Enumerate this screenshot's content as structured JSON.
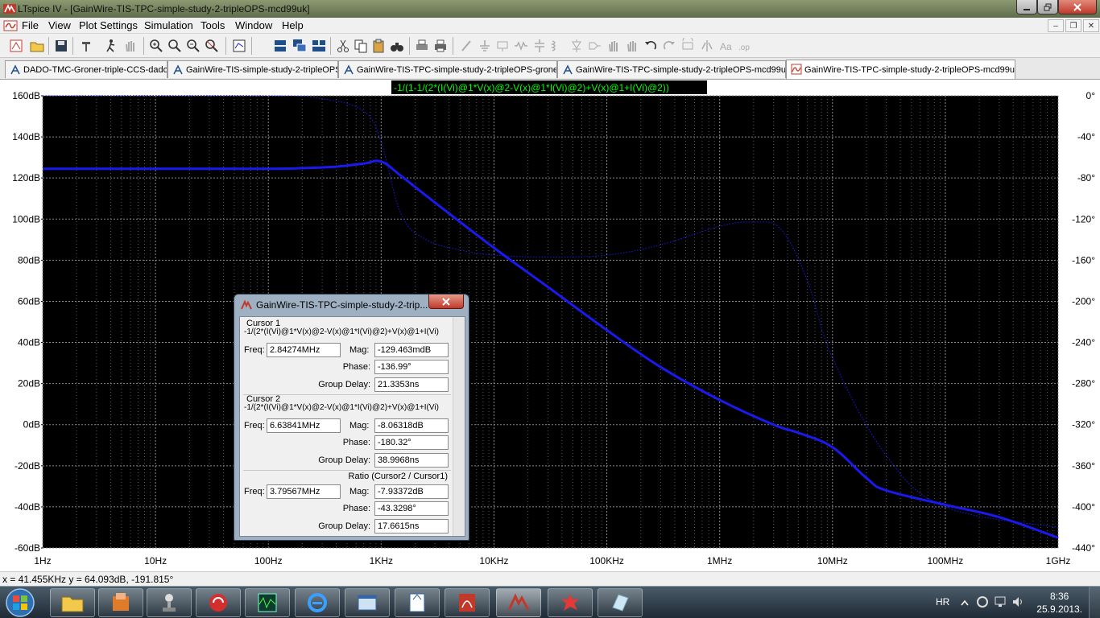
{
  "window": {
    "title": "LTspice IV - [GainWire-TIS-TPC-simple-study-2-tripleOPS-mcd99uk]"
  },
  "menu": [
    "File",
    "View",
    "Plot Settings",
    "Simulation",
    "Tools",
    "Window",
    "Help"
  ],
  "tabs": [
    {
      "label": "DADO-TMC-Groner-triple-CCS-dado",
      "kind": "schematic"
    },
    {
      "label": "GainWire-TIS-simple-study-2-tripleOPS",
      "kind": "schematic"
    },
    {
      "label": "GainWire-TIS-TPC-simple-study-2-tripleOPS-groner",
      "kind": "schematic"
    },
    {
      "label": "GainWire-TIS-TPC-simple-study-2-tripleOPS-mcd99uk",
      "kind": "schematic"
    },
    {
      "label": "GainWire-TIS-TPC-simple-study-2-tripleOPS-mcd99uk",
      "kind": "waveform",
      "active": true
    }
  ],
  "plot": {
    "trace_label": "-1/(1-1/(2*(I(Vi)@1*V(x)@2-V(x)@1*I(Vi)@2)+V(x)@1+I(Vi)@2))",
    "colors": {
      "background": "#000000",
      "grid": "#8a8a8a",
      "trace": "#1a1aee",
      "label": "#00ff00",
      "axis_text": "#000000"
    }
  },
  "chart_data": {
    "type": "line",
    "title": "",
    "xlabel": "",
    "ylabel": "",
    "x_scale": "log",
    "xlim": [
      1,
      1000000000
    ],
    "ylim": [
      -60,
      160
    ],
    "y2lim": [
      -440,
      0
    ],
    "x_tick_labels": [
      "1Hz",
      "10Hz",
      "100Hz",
      "1KHz",
      "10KHz",
      "100KHz",
      "1MHz",
      "10MHz",
      "100MHz",
      "1GHz"
    ],
    "y_tick_labels": [
      "160dB",
      "140dB",
      "120dB",
      "100dB",
      "80dB",
      "60dB",
      "40dB",
      "20dB",
      "0dB",
      "-20dB",
      "-40dB",
      "-60dB"
    ],
    "y2_tick_labels": [
      "0°",
      "-40°",
      "-80°",
      "-120°",
      "-160°",
      "-200°",
      "-240°",
      "-280°",
      "-320°",
      "-360°",
      "-400°",
      "-440°"
    ],
    "series": [
      {
        "style": "solid",
        "axis": "left",
        "x": [
          1,
          10,
          100,
          200,
          400,
          700,
          1000,
          1500,
          3000,
          10000,
          30000,
          100000,
          300000,
          1000000,
          3000000,
          5000000,
          10000000,
          20000000,
          30000000,
          100000000,
          300000000,
          1000000000
        ],
        "y": [
          124.5,
          124.5,
          124.5,
          124.8,
          125.5,
          127,
          128,
          121,
          108,
          86,
          67,
          46,
          28,
          12,
          0,
          -4,
          -11,
          -26,
          -32,
          -39,
          -45,
          -55
        ]
      },
      {
        "style": "dotted",
        "axis": "right",
        "x": [
          1,
          100,
          300,
          700,
          1000,
          1500,
          2500,
          5000,
          10000,
          30000,
          100000,
          300000,
          1000000,
          2000000,
          3500000,
          6000000,
          10000000,
          30000000,
          100000000,
          1000000000
        ],
        "y": [
          0,
          0,
          -3,
          -15,
          -45,
          -115,
          -140,
          -150,
          -155,
          -157,
          -155,
          -145,
          -127,
          -123,
          -130,
          -180,
          -255,
          -350,
          -400,
          -420
        ]
      }
    ]
  },
  "cursor_dialog": {
    "title": "GainWire-TIS-TPC-simple-study-2-trip...",
    "cursor1": {
      "heading": "Cursor 1",
      "expr": "-1/(2*(I(Vi)@1*V(x)@2-V(x)@1*I(Vi)@2)+V(x)@1+I(Vi)",
      "freq_label": "Freq:",
      "freq": "2.84274MHz",
      "mag_label": "Mag:",
      "mag": "-129.463mdB",
      "phase_label": "Phase:",
      "phase": "-136.99°",
      "gd_label": "Group Delay:",
      "gd": "21.3353ns"
    },
    "cursor2": {
      "heading": "Cursor 2",
      "expr": "-1/(2*(I(Vi)@1*V(x)@2-V(x)@1*I(Vi)@2)+V(x)@1+I(Vi)",
      "freq_label": "Freq:",
      "freq": "6.63841MHz",
      "mag_label": "Mag:",
      "mag": "-8.06318dB",
      "phase_label": "Phase:",
      "phase": "-180.32°",
      "gd_label": "Group Delay:",
      "gd": "38.9968ns"
    },
    "ratio": {
      "heading": "Ratio (Cursor2 / Cursor1)",
      "freq_label": "Freq:",
      "freq": "3.79567MHz",
      "mag_label": "Mag:",
      "mag": "-7.93372dB",
      "phase_label": "Phase:",
      "phase": "-43.3298°",
      "gd_label": "Group Delay:",
      "gd": "17.6615ns"
    }
  },
  "statusbar": {
    "text": "x = 41.455KHz   y = 64.093dB, -191.815°"
  },
  "taskbar": {
    "lang": "HR",
    "time": "8:36",
    "date": "25.9.2013."
  }
}
